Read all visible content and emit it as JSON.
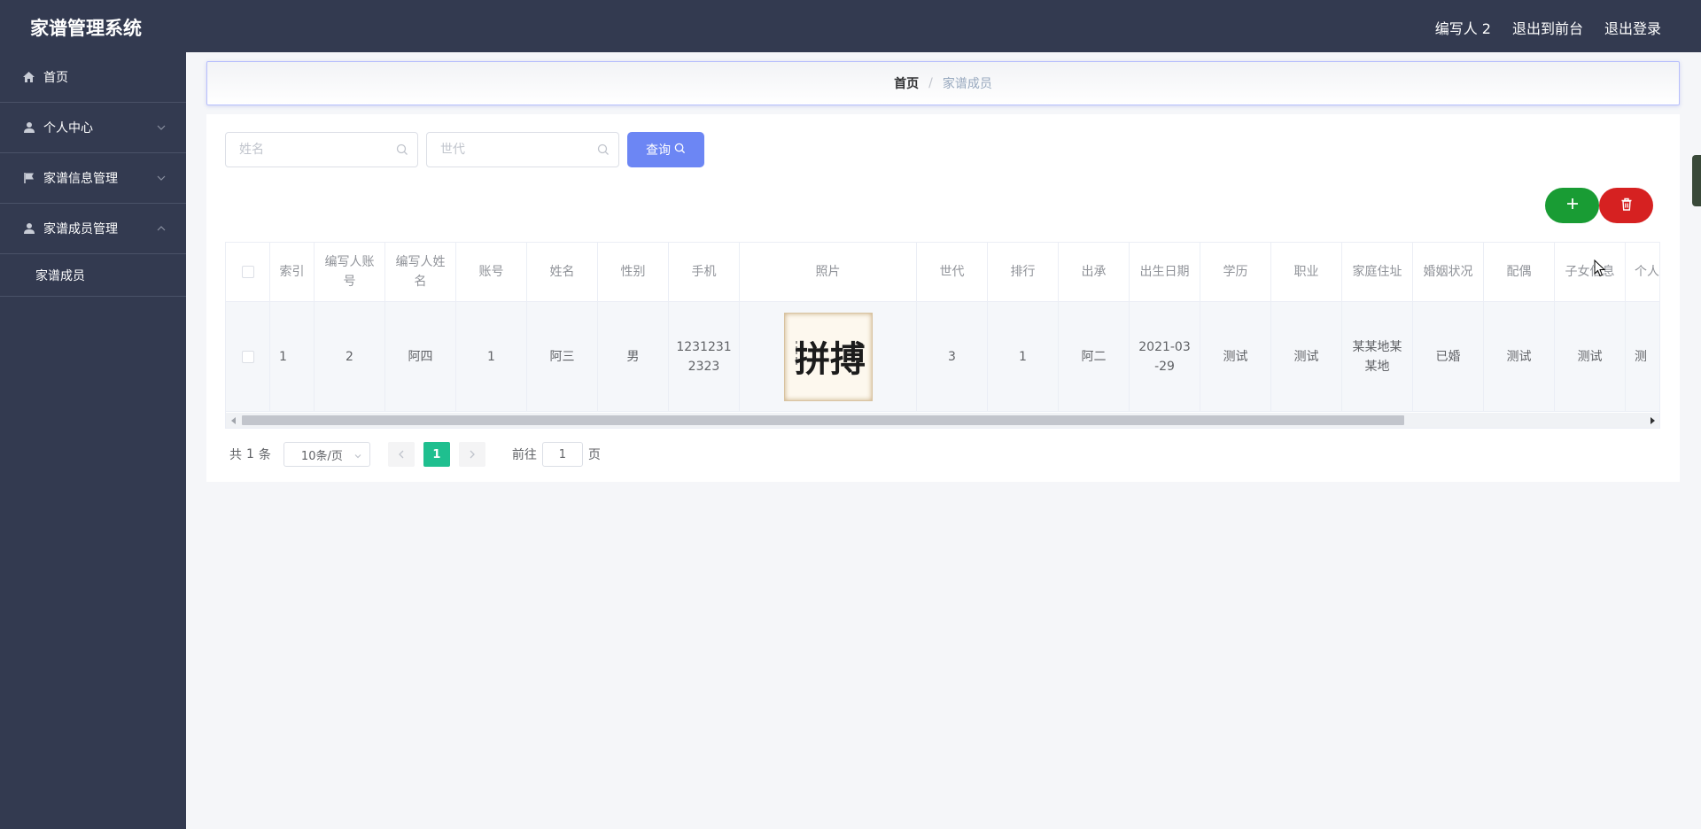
{
  "header": {
    "app_title": "家谱管理系统",
    "user_name": "编写人 2",
    "exit_front": "退出到前台",
    "logout": "退出登录"
  },
  "sidebar": {
    "items": [
      {
        "label": "首页",
        "icon": "home-icon"
      },
      {
        "label": "个人中心",
        "icon": "user-icon",
        "expanded": false
      },
      {
        "label": "家谱信息管理",
        "icon": "flag-icon",
        "expanded": false
      },
      {
        "label": "家谱成员管理",
        "icon": "user-icon",
        "expanded": true
      }
    ],
    "submenu": {
      "label": "家谱成员"
    }
  },
  "breadcrumb": {
    "home": "首页",
    "separator": "/",
    "current": "家谱成员"
  },
  "search": {
    "name_placeholder": "姓名",
    "generation_placeholder": "世代",
    "query_label": "查询"
  },
  "table": {
    "columns": [
      "索引",
      "编写人账号",
      "编写人姓名",
      "账号",
      "姓名",
      "性别",
      "手机",
      "照片",
      "世代",
      "排行",
      "出承",
      "出生日期",
      "学历",
      "职业",
      "家庭住址",
      "婚姻状况",
      "配偶",
      "子女信息",
      "个人"
    ],
    "rows": [
      {
        "index": "1",
        "writer_account": "2",
        "writer_name": "阿四",
        "account": "1",
        "name": "阿三",
        "gender": "男",
        "phone": "12312312323",
        "photo_text": "拼搏",
        "generation": "3",
        "rank": "1",
        "inherit": "阿二",
        "birth_date": "2021-03-29",
        "education": "测试",
        "occupation": "测试",
        "address": "某某地某某地",
        "marital_status": "已婚",
        "spouse": "测试",
        "children": "测试",
        "personal": "测"
      }
    ]
  },
  "pagination": {
    "total_prefix": "共",
    "total": "1",
    "total_suffix": "条",
    "page_size": "10条/页",
    "current_page": "1",
    "goto_label": "前往",
    "goto_value": "1",
    "page_suffix": "页"
  },
  "colors": {
    "sidebar_bg": "#333a50",
    "query_btn": "#6c86f4",
    "add_btn": "#199c34",
    "delete_btn": "#d62121",
    "active_page": "#1fbf8f"
  }
}
